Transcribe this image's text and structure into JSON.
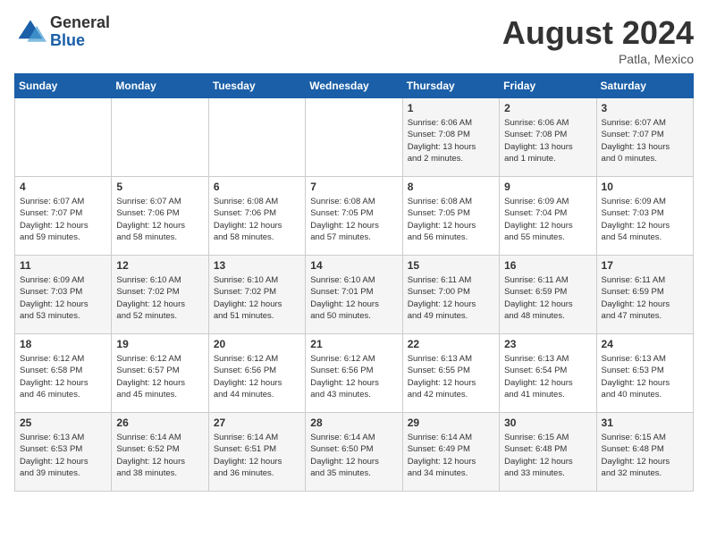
{
  "header": {
    "logo_general": "General",
    "logo_blue": "Blue",
    "month_title": "August 2024",
    "location": "Patla, Mexico"
  },
  "days_of_week": [
    "Sunday",
    "Monday",
    "Tuesday",
    "Wednesday",
    "Thursday",
    "Friday",
    "Saturday"
  ],
  "weeks": [
    [
      {
        "day": "",
        "info": ""
      },
      {
        "day": "",
        "info": ""
      },
      {
        "day": "",
        "info": ""
      },
      {
        "day": "",
        "info": ""
      },
      {
        "day": "1",
        "info": "Sunrise: 6:06 AM\nSunset: 7:08 PM\nDaylight: 13 hours\nand 2 minutes."
      },
      {
        "day": "2",
        "info": "Sunrise: 6:06 AM\nSunset: 7:08 PM\nDaylight: 13 hours\nand 1 minute."
      },
      {
        "day": "3",
        "info": "Sunrise: 6:07 AM\nSunset: 7:07 PM\nDaylight: 13 hours\nand 0 minutes."
      }
    ],
    [
      {
        "day": "4",
        "info": "Sunrise: 6:07 AM\nSunset: 7:07 PM\nDaylight: 12 hours\nand 59 minutes."
      },
      {
        "day": "5",
        "info": "Sunrise: 6:07 AM\nSunset: 7:06 PM\nDaylight: 12 hours\nand 58 minutes."
      },
      {
        "day": "6",
        "info": "Sunrise: 6:08 AM\nSunset: 7:06 PM\nDaylight: 12 hours\nand 58 minutes."
      },
      {
        "day": "7",
        "info": "Sunrise: 6:08 AM\nSunset: 7:05 PM\nDaylight: 12 hours\nand 57 minutes."
      },
      {
        "day": "8",
        "info": "Sunrise: 6:08 AM\nSunset: 7:05 PM\nDaylight: 12 hours\nand 56 minutes."
      },
      {
        "day": "9",
        "info": "Sunrise: 6:09 AM\nSunset: 7:04 PM\nDaylight: 12 hours\nand 55 minutes."
      },
      {
        "day": "10",
        "info": "Sunrise: 6:09 AM\nSunset: 7:03 PM\nDaylight: 12 hours\nand 54 minutes."
      }
    ],
    [
      {
        "day": "11",
        "info": "Sunrise: 6:09 AM\nSunset: 7:03 PM\nDaylight: 12 hours\nand 53 minutes."
      },
      {
        "day": "12",
        "info": "Sunrise: 6:10 AM\nSunset: 7:02 PM\nDaylight: 12 hours\nand 52 minutes."
      },
      {
        "day": "13",
        "info": "Sunrise: 6:10 AM\nSunset: 7:02 PM\nDaylight: 12 hours\nand 51 minutes."
      },
      {
        "day": "14",
        "info": "Sunrise: 6:10 AM\nSunset: 7:01 PM\nDaylight: 12 hours\nand 50 minutes."
      },
      {
        "day": "15",
        "info": "Sunrise: 6:11 AM\nSunset: 7:00 PM\nDaylight: 12 hours\nand 49 minutes."
      },
      {
        "day": "16",
        "info": "Sunrise: 6:11 AM\nSunset: 6:59 PM\nDaylight: 12 hours\nand 48 minutes."
      },
      {
        "day": "17",
        "info": "Sunrise: 6:11 AM\nSunset: 6:59 PM\nDaylight: 12 hours\nand 47 minutes."
      }
    ],
    [
      {
        "day": "18",
        "info": "Sunrise: 6:12 AM\nSunset: 6:58 PM\nDaylight: 12 hours\nand 46 minutes."
      },
      {
        "day": "19",
        "info": "Sunrise: 6:12 AM\nSunset: 6:57 PM\nDaylight: 12 hours\nand 45 minutes."
      },
      {
        "day": "20",
        "info": "Sunrise: 6:12 AM\nSunset: 6:56 PM\nDaylight: 12 hours\nand 44 minutes."
      },
      {
        "day": "21",
        "info": "Sunrise: 6:12 AM\nSunset: 6:56 PM\nDaylight: 12 hours\nand 43 minutes."
      },
      {
        "day": "22",
        "info": "Sunrise: 6:13 AM\nSunset: 6:55 PM\nDaylight: 12 hours\nand 42 minutes."
      },
      {
        "day": "23",
        "info": "Sunrise: 6:13 AM\nSunset: 6:54 PM\nDaylight: 12 hours\nand 41 minutes."
      },
      {
        "day": "24",
        "info": "Sunrise: 6:13 AM\nSunset: 6:53 PM\nDaylight: 12 hours\nand 40 minutes."
      }
    ],
    [
      {
        "day": "25",
        "info": "Sunrise: 6:13 AM\nSunset: 6:53 PM\nDaylight: 12 hours\nand 39 minutes."
      },
      {
        "day": "26",
        "info": "Sunrise: 6:14 AM\nSunset: 6:52 PM\nDaylight: 12 hours\nand 38 minutes."
      },
      {
        "day": "27",
        "info": "Sunrise: 6:14 AM\nSunset: 6:51 PM\nDaylight: 12 hours\nand 36 minutes."
      },
      {
        "day": "28",
        "info": "Sunrise: 6:14 AM\nSunset: 6:50 PM\nDaylight: 12 hours\nand 35 minutes."
      },
      {
        "day": "29",
        "info": "Sunrise: 6:14 AM\nSunset: 6:49 PM\nDaylight: 12 hours\nand 34 minutes."
      },
      {
        "day": "30",
        "info": "Sunrise: 6:15 AM\nSunset: 6:48 PM\nDaylight: 12 hours\nand 33 minutes."
      },
      {
        "day": "31",
        "info": "Sunrise: 6:15 AM\nSunset: 6:48 PM\nDaylight: 12 hours\nand 32 minutes."
      }
    ]
  ]
}
